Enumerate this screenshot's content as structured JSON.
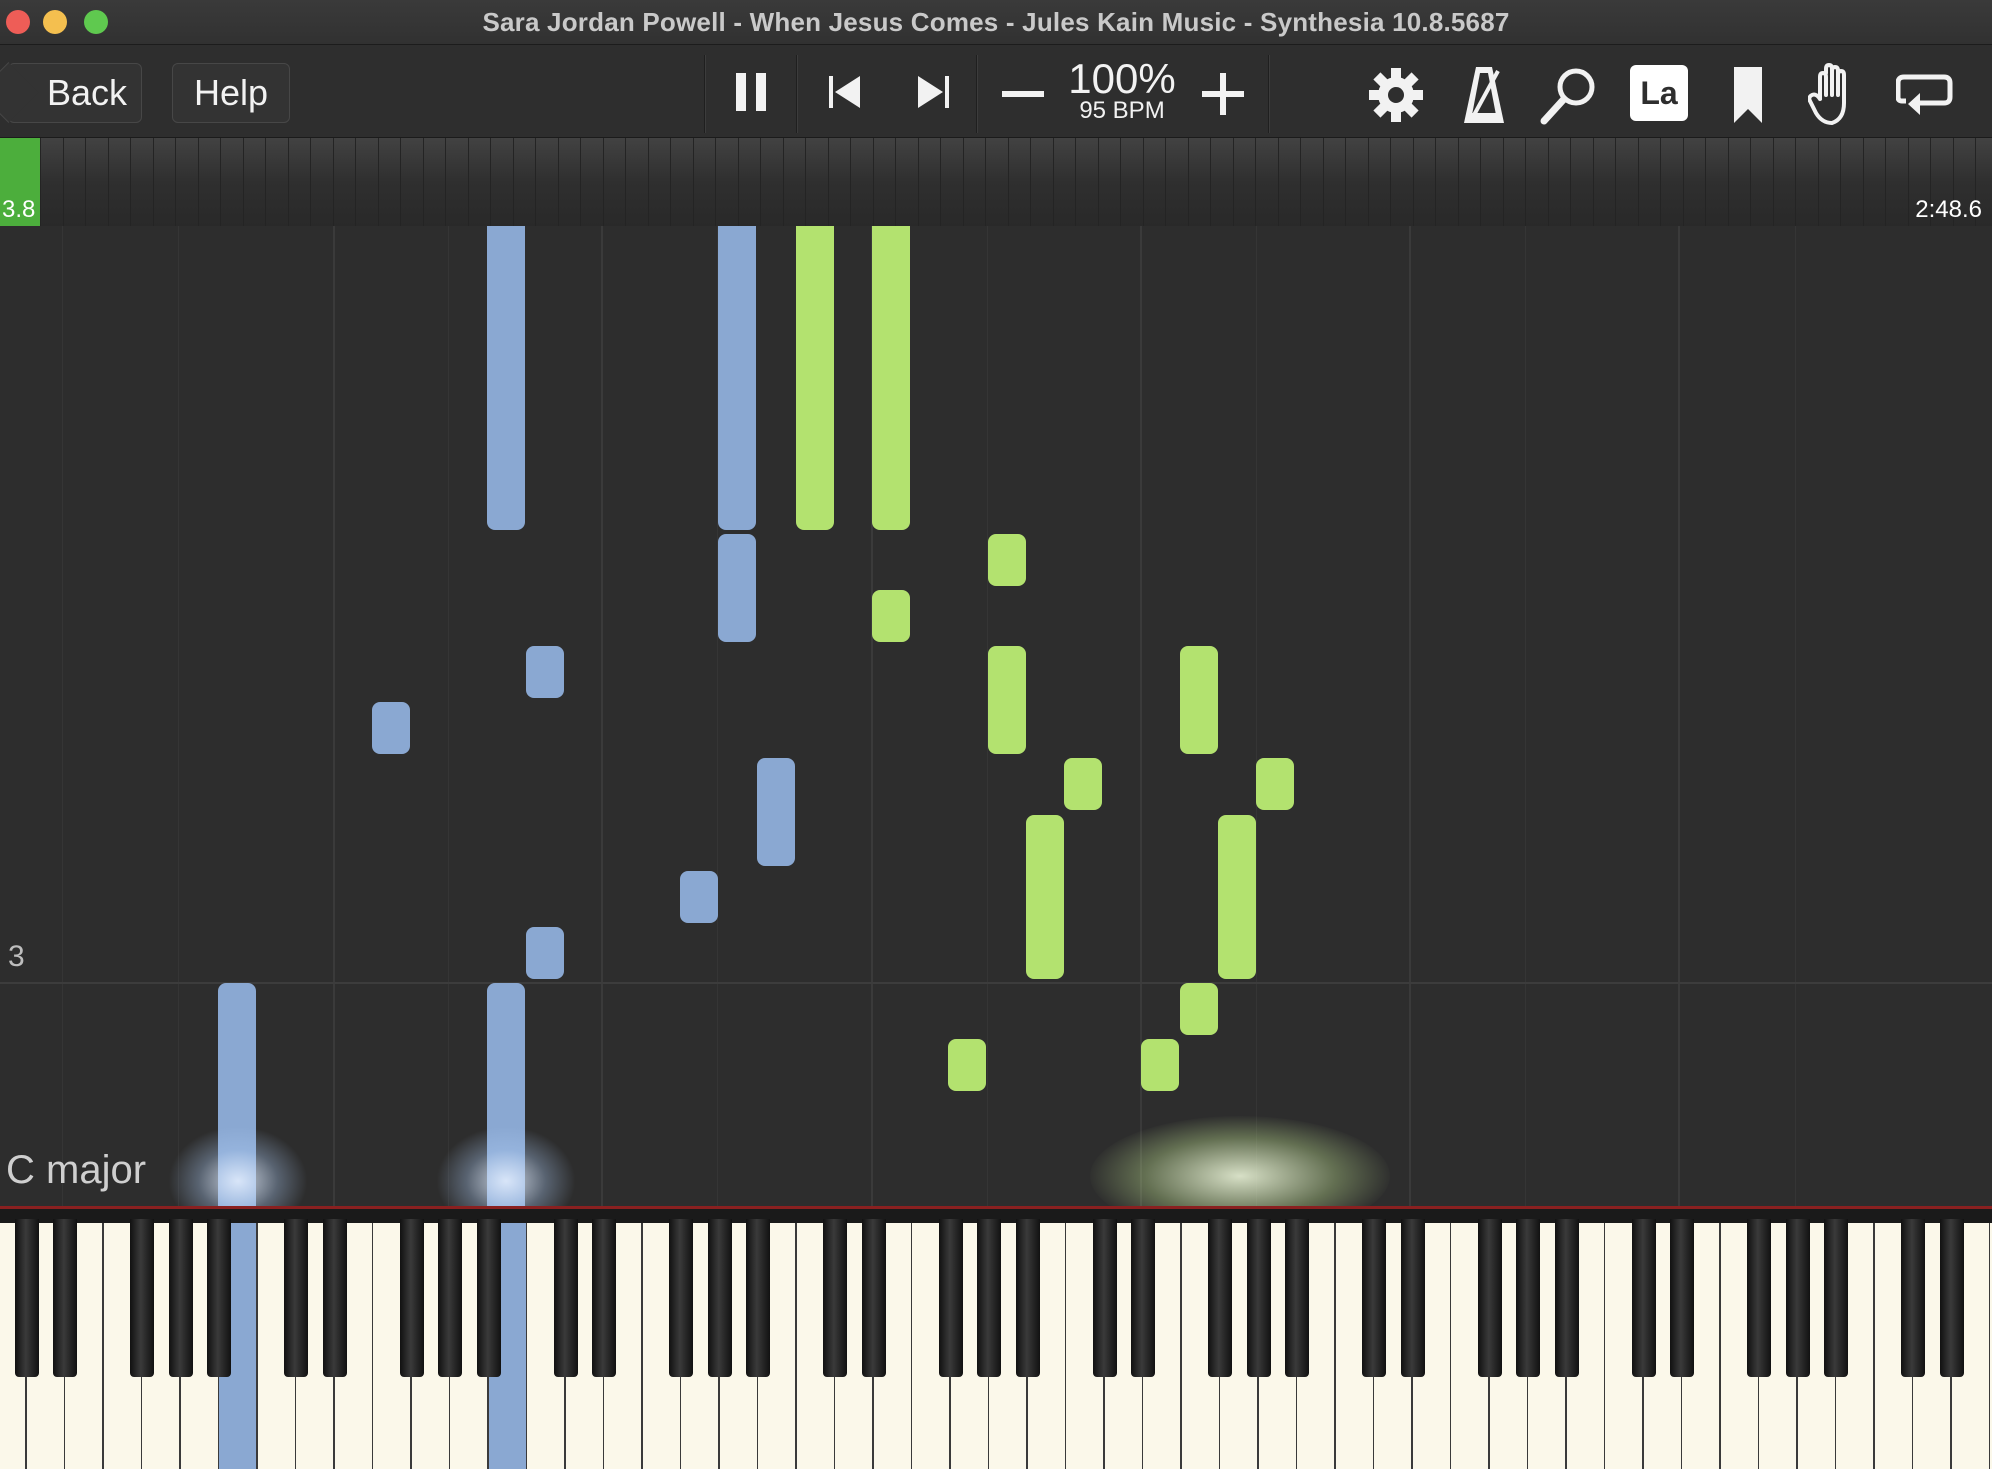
{
  "window": {
    "title": "Sara Jordan Powell - When Jesus Comes - Jules Kain Music - Synthesia 10.8.5687",
    "traffic_colors": [
      "#ee5d57",
      "#f4bf4f",
      "#5fc94f"
    ]
  },
  "toolbar": {
    "back_label": "Back",
    "help_label": "Help",
    "zoom_percent": "100%",
    "tempo": "95 BPM",
    "icons": [
      "pause-icon",
      "skip-back-icon",
      "skip-forward-icon",
      "minus-icon",
      "plus-icon",
      "gear-icon",
      "metronome-icon",
      "magnifier-icon",
      "note-labels-icon",
      "bookmark-icon",
      "hand-icon",
      "loop-icon"
    ],
    "note_labels_text": "La"
  },
  "timeline": {
    "start_time": "3.8",
    "end_time": "2:48.6",
    "progress_color": "#4cae3c"
  },
  "roll": {
    "measure_number": "3",
    "key_signature": "C major",
    "left_hand_color": "#8aa8d2",
    "right_hand_color": "#b3e26f"
  }
}
